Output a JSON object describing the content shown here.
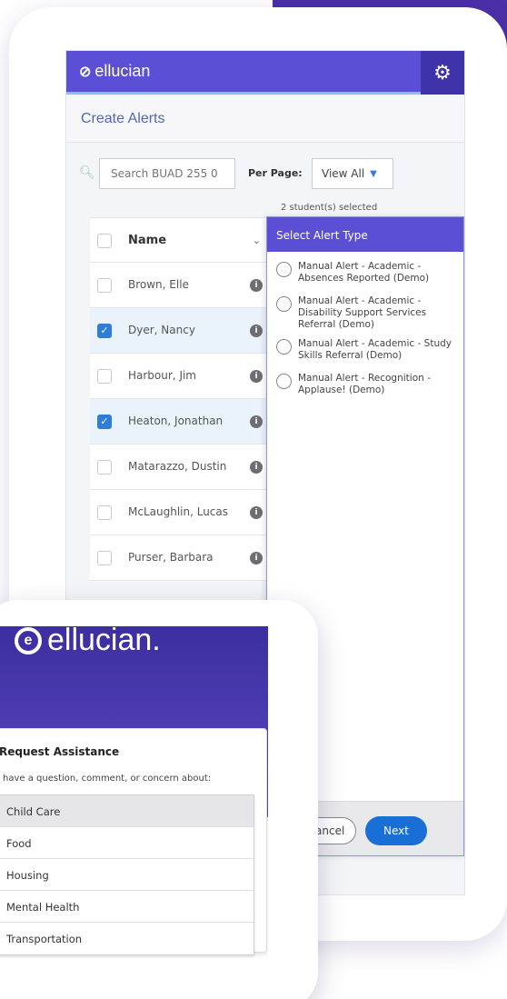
{
  "colors": {
    "brand_purple": "#5b4fd6",
    "link_blue": "#5068b3",
    "primary_button": "#1a6fd6",
    "checkbox_checked": "#2e7dd6"
  },
  "app": {
    "logo_text": "ellucian",
    "settings_icon": "gear-icon",
    "page_title": "Create Alerts",
    "search": {
      "placeholder": "Search BUAD 255 0",
      "icon": "search-icon"
    },
    "per_page": {
      "label": "Per Page:",
      "value": "View All"
    },
    "selected_count": "2 student(s) selected",
    "table": {
      "header": "Name",
      "rows": [
        {
          "name": "Brown, Elle",
          "checked": false
        },
        {
          "name": "Dyer, Nancy",
          "checked": true
        },
        {
          "name": "Harbour, Jim",
          "checked": false
        },
        {
          "name": "Heaton, Jonathan",
          "checked": true
        },
        {
          "name": "Matarazzo, Dustin",
          "checked": false
        },
        {
          "name": "McLaughlin, Lucas",
          "checked": false
        },
        {
          "name": "Purser, Barbara",
          "checked": false
        }
      ]
    },
    "alert_panel": {
      "title": "Select Alert Type",
      "options": [
        "Manual Alert - Academic - Absences Reported (Demo)",
        "Manual Alert - Academic - Disability Support Services Referral (Demo)",
        "Manual Alert - Academic - Study Skills Referral (Demo)",
        "Manual Alert - Recognition - Applause! (Demo)"
      ],
      "cancel_label": "Cancel",
      "next_label": "Next"
    }
  },
  "front_card": {
    "logo_text": "ellucian.",
    "request_title": "Request Assistance",
    "request_prompt": "have a question, comment, or concern about:",
    "options": [
      "Child Care",
      "Food",
      "Housing",
      "Mental Health",
      "Transportation"
    ]
  }
}
